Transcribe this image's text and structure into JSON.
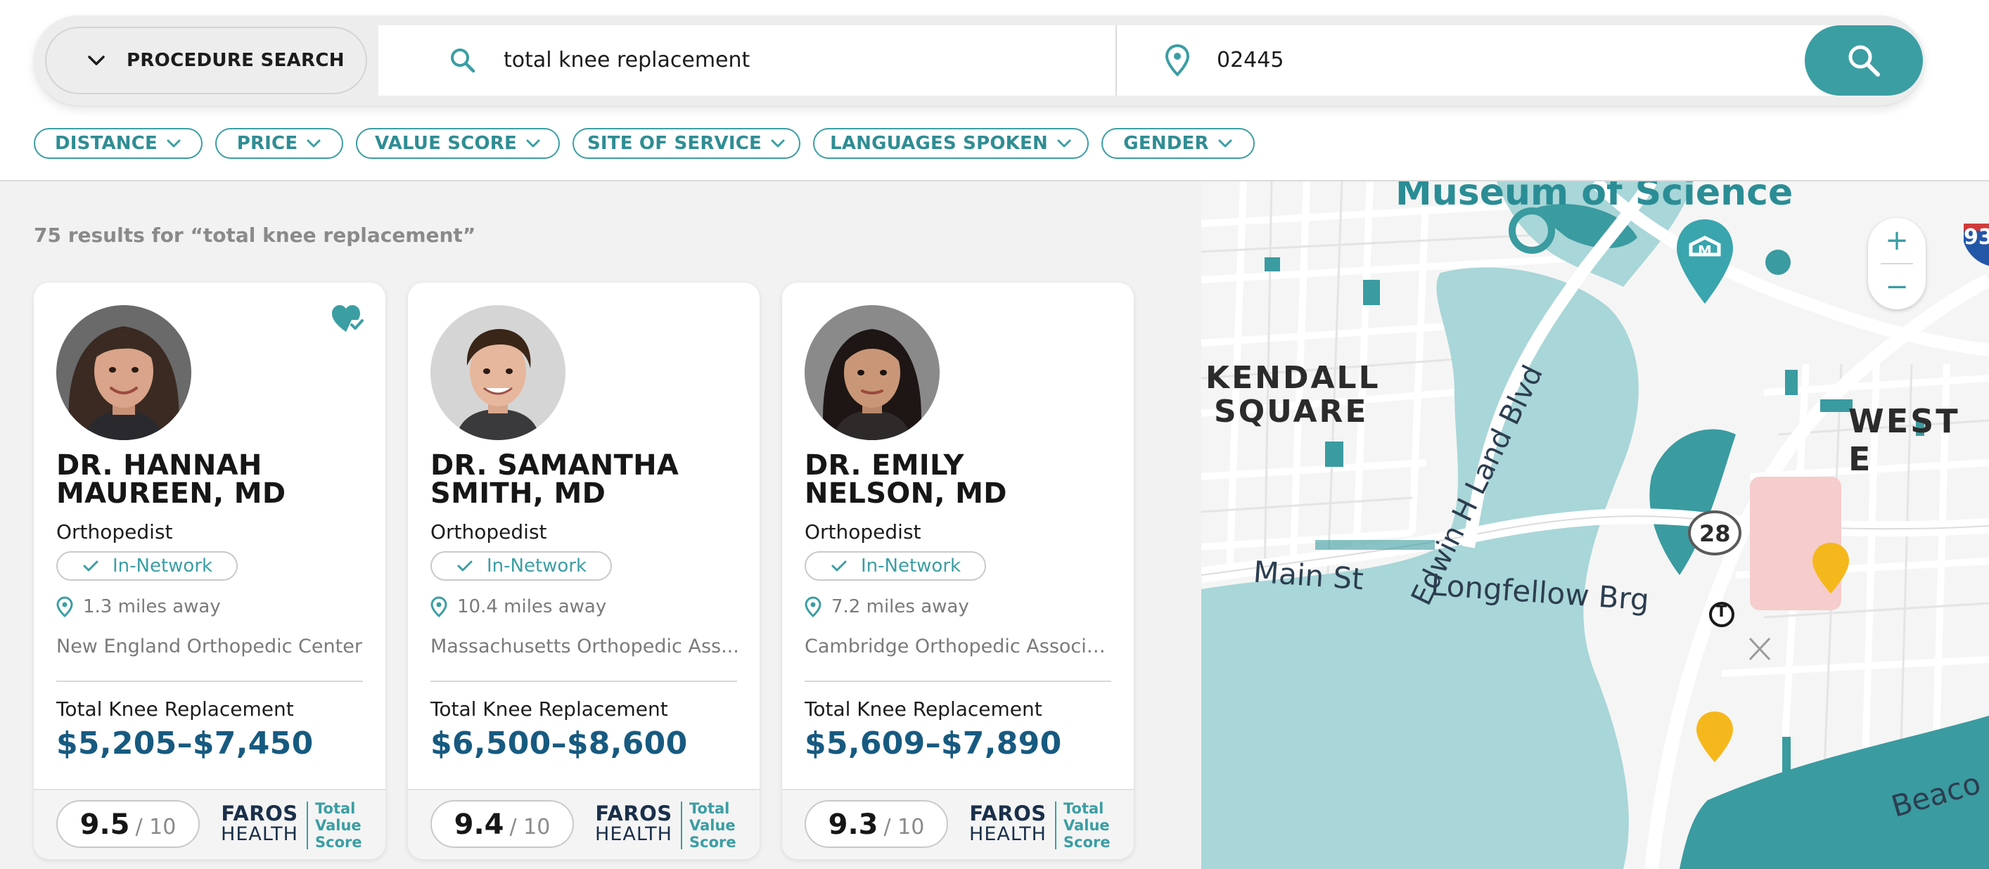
{
  "search": {
    "mode_label": "PROCEDURE SEARCH",
    "query": "total knee replacement",
    "location": "02445"
  },
  "filters": [
    "DISTANCE",
    "PRICE",
    "VALUE SCORE",
    "SITE OF SERVICE",
    "LANGUAGES SPOKEN",
    "GENDER"
  ],
  "results": {
    "count_text": "75 results for “total knee replacement”"
  },
  "cards": [
    {
      "name_line1": "DR. HANNAH",
      "name_line2": "MAUREEN, MD",
      "specialty": "Orthopedist",
      "network": "In-Network",
      "distance": "1.3 miles away",
      "facility": "New England Orthopedic Center",
      "procedure": "Total Knee Replacement",
      "price": "$5,205–$7,450",
      "score": "9.5",
      "score_max": "/ 10",
      "favorited": true
    },
    {
      "name_line1": "DR. SAMANTHA",
      "name_line2": "SMITH, MD",
      "specialty": "Orthopedist",
      "network": "In-Network",
      "distance": "10.4 miles away",
      "facility": "Massachusetts Orthopedic Ass...",
      "procedure": "Total Knee Replacement",
      "price": "$6,500–$8,600",
      "score": "9.4",
      "score_max": "/ 10",
      "favorited": false
    },
    {
      "name_line1": "DR. EMILY",
      "name_line2": "NELSON, MD",
      "specialty": "Orthopedist",
      "network": "In-Network",
      "distance": "7.2 miles away",
      "facility": "Cambridge Orthopedic Associat...",
      "procedure": "Total Knee Replacement",
      "price": "$5,609–$7,890",
      "score": "9.3",
      "score_max": "/ 10",
      "favorited": false
    }
  ],
  "brand": {
    "top": "FAROS",
    "bottom": "HEALTH",
    "tvs_1": "Total",
    "tvs_2": "Value",
    "tvs_3": "Score"
  },
  "map": {
    "labels": {
      "museum": "Museum of Science",
      "kendall_1": "KENDALL",
      "kendall_2": "SQUARE",
      "west": "WEST E",
      "land_blvd": "Edwin H Land Blvd",
      "main_st": "Main St",
      "longfellow": "Longfellow Brg",
      "route": "28",
      "interstate": "93",
      "beacon": "Beaco",
      "transit": "T"
    },
    "zoom_in": "+",
    "zoom_out": "−"
  },
  "colors": {
    "accent": "#3b9ea3",
    "price": "#175a80",
    "water": "#a9d6d8",
    "water_dark": "#3a9ba0",
    "pin": "#f5b81c"
  }
}
